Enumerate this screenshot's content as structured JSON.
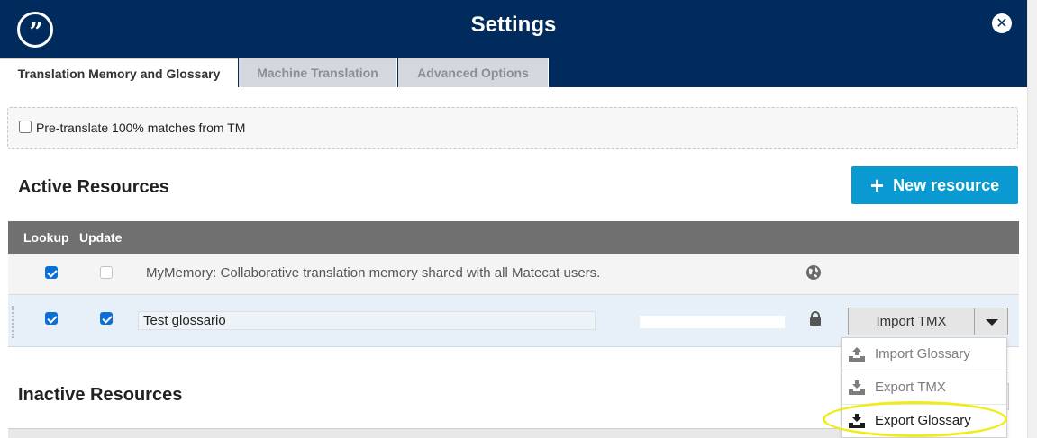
{
  "header": {
    "title": "Settings",
    "logo_glyph": "”",
    "close_glyph": "✕"
  },
  "tabs": [
    {
      "label": "Translation Memory and Glossary",
      "active": true
    },
    {
      "label": "Machine Translation",
      "active": false
    },
    {
      "label": "Advanced Options",
      "active": false
    }
  ],
  "pretranslate": {
    "label": "Pre-translate 100% matches from TM",
    "checked": false
  },
  "active_resources": {
    "title": "Active Resources",
    "new_resource_label": "New resource",
    "columns": [
      "Lookup",
      "Update"
    ],
    "rows": [
      {
        "lookup": true,
        "update": false,
        "name": "MyMemory: Collaborative translation memory shared with all Matecat users.",
        "icon": "globe-icon"
      },
      {
        "lookup": true,
        "update": true,
        "name": "Test glossario",
        "icon": "lock-icon",
        "action_label": "Import TMX"
      }
    ]
  },
  "dropdown": {
    "items": [
      {
        "label": "Import Glossary",
        "icon": "upload-icon"
      },
      {
        "label": "Export TMX",
        "icon": "download-icon"
      },
      {
        "label": "Export Glossary",
        "icon": "download-icon",
        "highlighted": true
      }
    ]
  },
  "inactive_resources": {
    "title": "Inactive Resources"
  },
  "colors": {
    "header_bg": "#002b5c",
    "primary_button": "#0a99d0",
    "table_head": "#707070",
    "highlight_ring": "#f0ec1c",
    "checkbox_on": "#0a6fd6"
  }
}
